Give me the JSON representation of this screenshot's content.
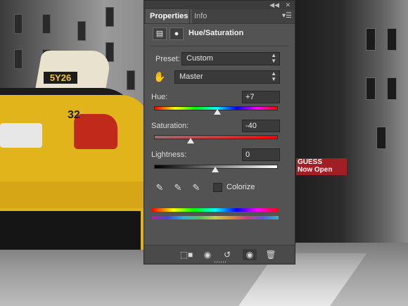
{
  "photo": {
    "taxi_sign": "5Y26",
    "taxi_number": "32",
    "storefront_sign_line1": "GUESS",
    "storefront_sign_line2": "Now Open"
  },
  "panel": {
    "tabs": [
      {
        "label": "Properties",
        "active": true
      },
      {
        "label": "Info",
        "active": false
      }
    ],
    "collapse_icon": "double-chevron-right-icon",
    "close_icon": "close-icon",
    "menu_icon": "panel-menu-icon",
    "adjustment_icon": "adjustment-layer-icon",
    "mask_icon": "layer-mask-icon",
    "title": "Hue/Saturation",
    "preset": {
      "label": "Preset:",
      "value": "Custom"
    },
    "channel": {
      "value": "Master"
    },
    "hue": {
      "label": "Hue:",
      "value": "+7",
      "slider_fraction": 0.52
    },
    "saturation": {
      "label": "Saturation:",
      "value": "-40",
      "slider_fraction": 0.3
    },
    "lightness": {
      "label": "Lightness:",
      "value": "0",
      "slider_fraction": 0.5
    },
    "colorize": {
      "label": "Colorize",
      "checked": false
    },
    "bottom_icons": [
      "clip-to-layer-icon",
      "view-previous-state-icon",
      "reset-icon",
      "toggle-visibility-icon",
      "delete-icon"
    ]
  }
}
